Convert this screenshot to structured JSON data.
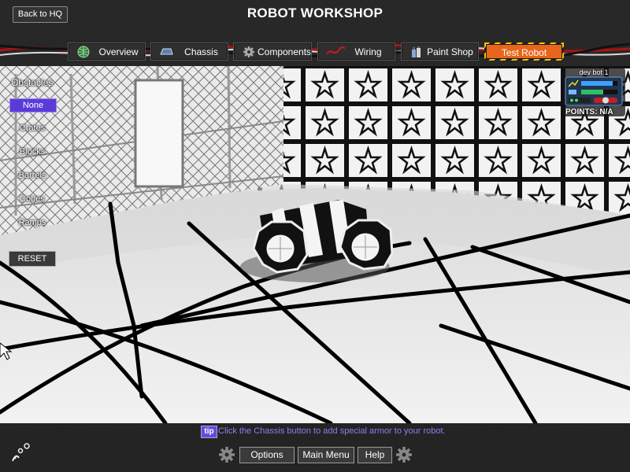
{
  "header": {
    "title": "ROBOT WORKSHOP",
    "back_label": "Back to HQ",
    "tabs": [
      {
        "label": "Overview",
        "icon": "globe-icon"
      },
      {
        "label": "Chassis",
        "icon": "chassis-icon"
      },
      {
        "label": "Components",
        "icon": "gear-icon"
      },
      {
        "label": "Wiring",
        "icon": "wire-icon"
      },
      {
        "label": "Paint Shop",
        "icon": "spray-can-icon"
      },
      {
        "label": "Test Robot",
        "icon": ""
      }
    ],
    "active_tab": "Test Robot"
  },
  "obstacles": {
    "label": "Obstacles",
    "items": [
      "None",
      "Crates",
      "Blocks",
      "Barrels",
      "Cones",
      "Ramps"
    ],
    "selected": "None",
    "reset_label": "RESET"
  },
  "status": {
    "bot_name": "dev bot 1",
    "points_label": "POINTS:",
    "points_value": "N/A"
  },
  "footer": {
    "tip_badge": "tip",
    "tip_text": "Click the Chassis button to add special armor to your robot.",
    "buttons": [
      "Options",
      "Main Menu",
      "Help"
    ]
  },
  "colors": {
    "accent_orange": "#e7651c",
    "accent_purple": "#5b3bd8",
    "tip_text": "#8f7ef0"
  }
}
